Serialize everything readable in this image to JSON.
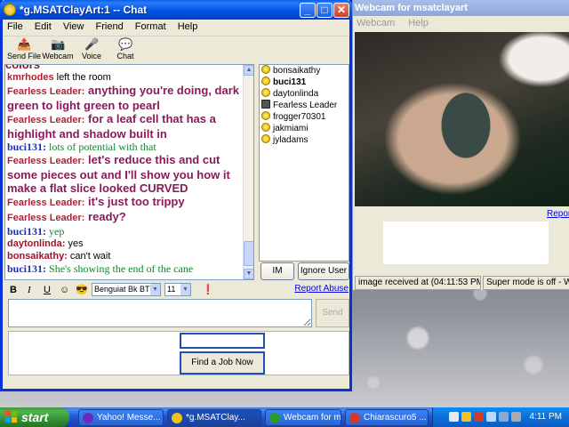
{
  "webcam": {
    "title": "Webcam for msatclayart",
    "menu": [
      "Webcam",
      "Help"
    ],
    "report_link": "Report",
    "status_left": "image received at (04:11:53 PM)",
    "status_right": "Super mode is off - What"
  },
  "chat": {
    "title": "*g.MSATClayArt:1 -- Chat",
    "menu": [
      "File",
      "Edit",
      "View",
      "Friend",
      "Format",
      "Help"
    ],
    "toolbar": {
      "send_file": "Send File",
      "webcam": "Webcam",
      "voice": "Voice",
      "chat": "Chat"
    },
    "log_cut_text": "colors",
    "messages": [
      {
        "user": "kmrhodes",
        "text": " left the room",
        "style": "normal",
        "user_color": "#c0182c",
        "text_color": "#000000"
      },
      {
        "user": "Fearless Leader:",
        "text": " anything you're doing, dark green to light green to pearl",
        "style": "big",
        "user_color": "#b22233",
        "text_color": "#8b1a5a"
      },
      {
        "user": "Fearless Leader:",
        "text": " for a leaf cell that has a highlight and shadow built in",
        "style": "big",
        "user_color": "#b22233",
        "text_color": "#8b1a5a"
      },
      {
        "user": "buci131:",
        "text": " lots of potential with that",
        "style": "serif",
        "user_color": "#1a2fc0",
        "text_color": "#0a8a2a"
      },
      {
        "user": "Fearless Leader:",
        "text": " let's reduce this and cut some pieces out and I'll show you how it make a flat slice looked CURVED",
        "style": "big",
        "user_color": "#b22233",
        "text_color": "#8b1a5a"
      },
      {
        "user": "Fearless Leader:",
        "text": " it's just too trippy",
        "style": "big",
        "user_color": "#b22233",
        "text_color": "#8b1a5a"
      },
      {
        "user": "Fearless Leader:",
        "text": " ready?",
        "style": "big",
        "user_color": "#b22233",
        "text_color": "#8b1a5a"
      },
      {
        "user": "buci131:",
        "text": " yep",
        "style": "serif",
        "user_color": "#1a2fc0",
        "text_color": "#0a8a2a"
      },
      {
        "user": "daytonlinda:",
        "text": " yes",
        "style": "normal",
        "user_color": "#a0122a",
        "text_color": "#000000"
      },
      {
        "user": "bonsaikathy:",
        "text": " can't wait",
        "style": "normal",
        "user_color": "#a0122a",
        "text_color": "#000000"
      },
      {
        "user": "buci131:",
        "text": " She's showing the end of the cane",
        "style": "serif",
        "user_color": "#1a2fc0",
        "text_color": "#0a8a2a"
      }
    ],
    "users": [
      {
        "name": "bonsaikathy",
        "bold": false,
        "cam": false
      },
      {
        "name": "buci131",
        "bold": true,
        "cam": false
      },
      {
        "name": "daytonlinda",
        "bold": false,
        "cam": false
      },
      {
        "name": "Fearless Leader",
        "bold": false,
        "cam": true
      },
      {
        "name": "frogger70301",
        "bold": false,
        "cam": false
      },
      {
        "name": "jakmiami",
        "bold": false,
        "cam": false
      },
      {
        "name": "jyladams",
        "bold": false,
        "cam": false
      }
    ],
    "im_button": "IM",
    "ignore_button": "Ignore User",
    "format": {
      "bold": "B",
      "italic": "I",
      "underline": "U",
      "font": "Benguiat Bk BT",
      "size": "11"
    },
    "report_abuse": "Report Abuse",
    "input_value": "",
    "send_button": "Send",
    "ad_button": "Find a Job Now"
  },
  "taskbar": {
    "start": "start",
    "tasks": [
      {
        "label": "Yahoo! Messe...",
        "color": "#6b2bb8"
      },
      {
        "label": "*g.MSATClay...",
        "color": "#f2c21a"
      },
      {
        "label": "Webcam for m...",
        "color": "#2a9a2a"
      },
      {
        "label": "Chiarascuro5 ...",
        "color": "#d23b2b"
      }
    ],
    "clock": "4:11 PM"
  },
  "colors": {
    "title_blue": "#0054e3",
    "taskbar_blue": "#245edb",
    "start_green": "#3c9a3c"
  }
}
